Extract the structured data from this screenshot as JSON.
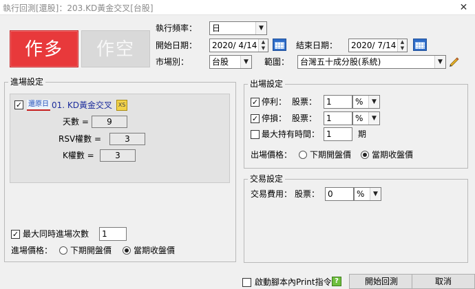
{
  "window": {
    "title": "執行回測[還股]：203.KD黃金交叉[台股]",
    "close": "✕"
  },
  "mode": {
    "long_label": "作多",
    "short_label": "作空"
  },
  "settings": {
    "frequency_label": "執行頻率：",
    "frequency_value": "日",
    "start_label": "開始日期：",
    "start_value": "2020/ 4/14",
    "end_label": "結束日期：",
    "end_value": "2020/ 7/14",
    "market_label": "市場別：",
    "market_value": "台股",
    "scope_label": "範圍：",
    "scope_value": "台灣五十成分股(系統)"
  },
  "entry": {
    "legend": "進場設定",
    "strategy_tag": "還原日",
    "strategy_name": "01. KD黃金交叉",
    "params": [
      {
        "label": "天數 =",
        "value": "9"
      },
      {
        "label": "RSV權數 =",
        "value": "3"
      },
      {
        "label": "K權數 =",
        "value": "3"
      }
    ],
    "max_entries_label": "最大同時進場次數",
    "max_entries_value": "1",
    "price_label": "進場價格：",
    "price_opt1": "下期開盤價",
    "price_opt2": "當期收盤價"
  },
  "exit": {
    "legend": "出場設定",
    "take_profit_label": "停利：",
    "take_profit_kind": "股票：",
    "take_profit_value": "1",
    "take_profit_unit": "%",
    "stop_loss_label": "停損：",
    "stop_loss_kind": "股票：",
    "stop_loss_value": "1",
    "stop_loss_unit": "%",
    "max_hold_label": "最大持有時間：",
    "max_hold_value": "1",
    "max_hold_unit": "期",
    "price_label": "出場價格：",
    "price_opt1": "下期開盤價",
    "price_opt2": "當期收盤價"
  },
  "trade": {
    "legend": "交易設定",
    "fee_label": "交易費用：",
    "fee_kind": "股票：",
    "fee_value": "0",
    "fee_unit": "%"
  },
  "footer": {
    "print_label": "啟動腳本內Print指令",
    "help": "?",
    "start_button": "開始回測",
    "cancel_button": "取消"
  }
}
